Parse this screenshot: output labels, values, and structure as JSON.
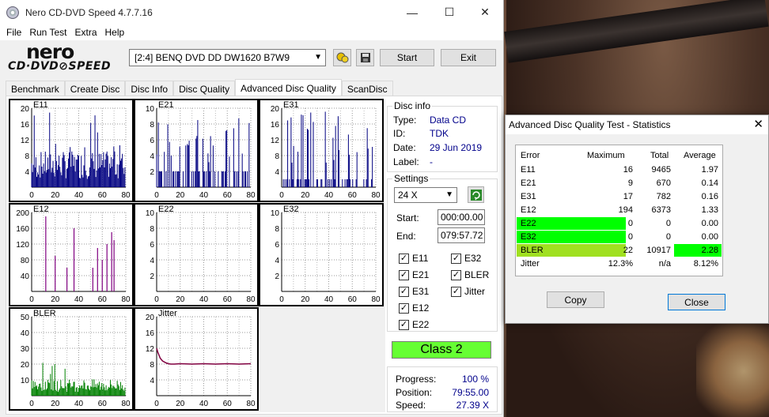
{
  "window": {
    "title": "Nero CD-DVD Speed 4.7.7.16",
    "min": "—",
    "max": "☐",
    "close": "✕"
  },
  "menu": [
    "File",
    "Run Test",
    "Extra",
    "Help"
  ],
  "logo": {
    "top": "nero",
    "bottom": "CD·DVD⊘SPEED"
  },
  "drive": {
    "selected": "[2:4]   BENQ DVD DD DW1620 B7W9"
  },
  "toolbar": {
    "start": "Start",
    "exit": "Exit"
  },
  "tabs": [
    "Benchmark",
    "Create Disc",
    "Disc Info",
    "Disc Quality",
    "Advanced Disc Quality",
    "ScanDisc"
  ],
  "disc_info": {
    "title": "Disc info",
    "type_label": "Type:",
    "type": "Data CD",
    "id_label": "ID:",
    "id": "TDK",
    "date_label": "Date:",
    "date": "29 Jun 2019",
    "label_label": "Label:",
    "label": "-"
  },
  "settings": {
    "title": "Settings",
    "speed": "24 X",
    "start_label": "Start:",
    "start": "000:00.00",
    "end_label": "End:",
    "end": "079:57.72"
  },
  "checks": {
    "e11": "E11",
    "e32": "E32",
    "e21": "E21",
    "bler": "BLER",
    "e31": "E31",
    "jitter": "Jitter",
    "e12": "E12",
    "e22": "E22"
  },
  "class_label": "Class 2",
  "progress": {
    "progress_label": "Progress:",
    "progress": "100 %",
    "position_label": "Position:",
    "position": "79:55.00",
    "speed_label": "Speed:",
    "speed": "27.39 X"
  },
  "chart_data": [
    {
      "type": "bar",
      "title": "E11",
      "ylim": [
        0,
        20
      ],
      "yticks": [
        4,
        8,
        12,
        16,
        20
      ],
      "xlim": [
        0,
        80
      ],
      "xticks": [
        0,
        20,
        40,
        60,
        80
      ],
      "color": "#000080",
      "level": 7
    },
    {
      "type": "bar",
      "title": "E21",
      "ylim": [
        0,
        10
      ],
      "yticks": [
        2,
        4,
        6,
        8,
        10
      ],
      "xlim": [
        0,
        80
      ],
      "xticks": [
        0,
        20,
        40,
        60,
        80
      ],
      "color": "#000080",
      "level": 2
    },
    {
      "type": "bar",
      "title": "E31",
      "ylim": [
        0,
        20
      ],
      "yticks": [
        4,
        8,
        12,
        16,
        20
      ],
      "xlim": [
        0,
        80
      ],
      "xticks": [
        0,
        20,
        40,
        60,
        80
      ],
      "color": "#000080",
      "level": 2
    },
    {
      "type": "bar",
      "title": "E12",
      "ylim": [
        0,
        200
      ],
      "yticks": [
        40,
        80,
        120,
        160,
        200
      ],
      "xlim": [
        0,
        80
      ],
      "xticks": [
        0,
        20,
        40,
        60,
        80
      ],
      "color": "#800080",
      "level": 0
    },
    {
      "type": "bar",
      "title": "E22",
      "ylim": [
        0,
        10
      ],
      "yticks": [
        2,
        4,
        6,
        8,
        10
      ],
      "xlim": [
        0,
        80
      ],
      "xticks": [
        0,
        20,
        40,
        60,
        80
      ],
      "color": "#000080",
      "level": 0
    },
    {
      "type": "bar",
      "title": "E32",
      "ylim": [
        0,
        10
      ],
      "yticks": [
        2,
        4,
        6,
        8,
        10
      ],
      "xlim": [
        0,
        80
      ],
      "xticks": [
        0,
        20,
        40,
        60,
        80
      ],
      "color": "#000080",
      "level": 0
    },
    {
      "type": "bar",
      "title": "BLER",
      "ylim": [
        0,
        50
      ],
      "yticks": [
        10,
        20,
        30,
        40,
        50
      ],
      "xlim": [
        0,
        80
      ],
      "xticks": [
        0,
        20,
        40,
        60,
        80
      ],
      "color": "#008000",
      "level": 8
    },
    {
      "type": "line",
      "title": "Jitter",
      "ylim": [
        0,
        20
      ],
      "yticks": [
        4,
        8,
        12,
        16,
        20
      ],
      "xlim": [
        0,
        80
      ],
      "xticks": [
        0,
        20,
        40,
        60,
        80
      ],
      "color": "#800040",
      "x": [
        0,
        1,
        3,
        5,
        8,
        10,
        12,
        15,
        20,
        30,
        40,
        50,
        60,
        70,
        80
      ],
      "y": [
        12,
        11,
        9.5,
        8.8,
        8.3,
        8.1,
        8.0,
        8.0,
        8.1,
        8.0,
        8.1,
        8.0,
        8.1,
        8.0,
        8.1
      ]
    }
  ],
  "stats": {
    "title": "Advanced Disc Quality Test - Statistics",
    "close_x": "✕",
    "headers": [
      "Error",
      "Maximum",
      "Total",
      "Average"
    ],
    "rows": [
      [
        "E11",
        "16",
        "9465",
        "1.97"
      ],
      [
        "E21",
        "9",
        "670",
        "0.14"
      ],
      [
        "E31",
        "17",
        "782",
        "0.16"
      ],
      [
        "E12",
        "194",
        "6373",
        "1.33"
      ],
      [
        "E22",
        "0",
        "0",
        "0.00"
      ],
      [
        "E32",
        "0",
        "0",
        "0.00"
      ],
      [
        "BLER",
        "22",
        "10917",
        "2.28"
      ],
      [
        "Jitter",
        "12.3%",
        "n/a",
        "8.12%"
      ]
    ],
    "copy": "Copy",
    "close": "Close",
    "colors": {
      "highlight": "#00ff00",
      "bler": "#a0e020"
    }
  }
}
